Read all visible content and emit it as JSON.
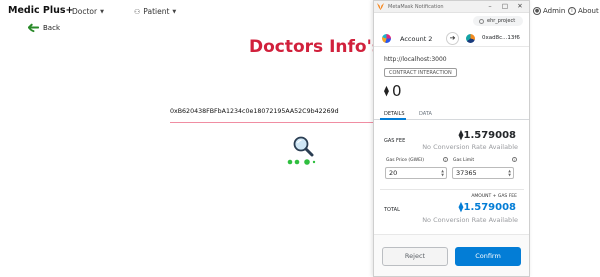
{
  "app": {
    "brand": "Medic Plus+",
    "nav": {
      "doctor": "Doctor",
      "patient": "Patient",
      "admin": "Admin",
      "about": "About"
    },
    "back_label": "Back",
    "page_title": "Doctors Info's",
    "address_value": "0xB620438FBFbA1234c0e18072195AA52C9b42269d",
    "colors": {
      "title": "#d1213c",
      "loader": "#2fbf3f",
      "underline": "#f08da2"
    }
  },
  "metamask": {
    "window_title": "MetaMask Notification",
    "network": "ehr_project",
    "from_account": "Account 2",
    "to_address": "0xad8c...13f6",
    "origin": "http://localhost:3000",
    "badge": "CONTRACT INTERACTION",
    "amount": "0",
    "tabs": [
      "DETAILS",
      "DATA"
    ],
    "gas_fee_label": "GAS FEE",
    "gas_fee_value": "1.579008",
    "gas_fee_conversion": "No Conversion Rate Available",
    "gas_price_label": "Gas Price (GWEI)",
    "gas_price_value": "20",
    "gas_limit_label": "Gas Limit",
    "gas_limit_value": "37365",
    "amount_gas_label": "AMOUNT + GAS FEE",
    "total_label": "TOTAL",
    "total_value": "1.579008",
    "total_conversion": "No Conversion Rate Available",
    "reject_label": "Reject",
    "confirm_label": "Confirm",
    "eth_symbol": "⧫",
    "colors": {
      "accent": "#037dd6"
    }
  }
}
